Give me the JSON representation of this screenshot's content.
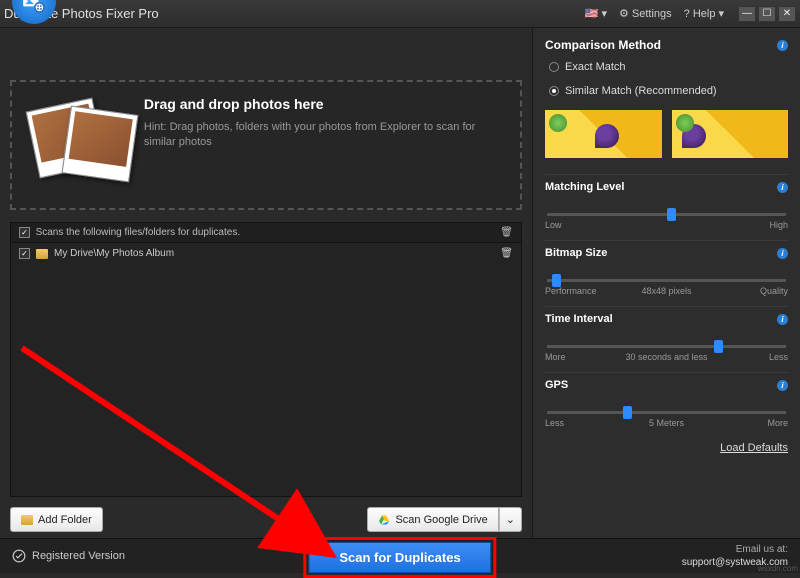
{
  "titlebar": {
    "title": "Duplicate Photos Fixer Pro",
    "settings": "Settings",
    "help": "? Help",
    "lang_flag": "🇺🇸"
  },
  "dropzone": {
    "heading": "Drag and drop photos here",
    "hint": "Hint: Drag photos, folders with your photos from Explorer to scan for similar photos"
  },
  "folderlist": {
    "header": "Scans the following files/folders for duplicates.",
    "items": [
      {
        "checked": true,
        "path": "My Drive\\My Photos Album"
      }
    ]
  },
  "buttons": {
    "add_folder": "Add Folder",
    "scan_drive": "Scan Google Drive",
    "scan": "Scan for Duplicates"
  },
  "status": {
    "registered": "Registered Version",
    "email_label": "Email us at:",
    "email": "support@systweak.com"
  },
  "compare": {
    "method_title": "Comparison Method",
    "exact": "Exact Match",
    "similar": "Similar Match (Recommended)",
    "matching_level": {
      "title": "Matching Level",
      "low": "Low",
      "high": "High"
    },
    "bitmap": {
      "title": "Bitmap Size",
      "low": "Performance",
      "mid": "48x48 pixels",
      "high": "Quality"
    },
    "time": {
      "title": "Time Interval",
      "low": "More",
      "mid": "30 seconds and less",
      "high": "Less"
    },
    "gps": {
      "title": "GPS",
      "low": "Less",
      "mid": "5 Meters",
      "high": "More"
    },
    "defaults": "Load Defaults"
  },
  "watermark": "wsxdn.com"
}
